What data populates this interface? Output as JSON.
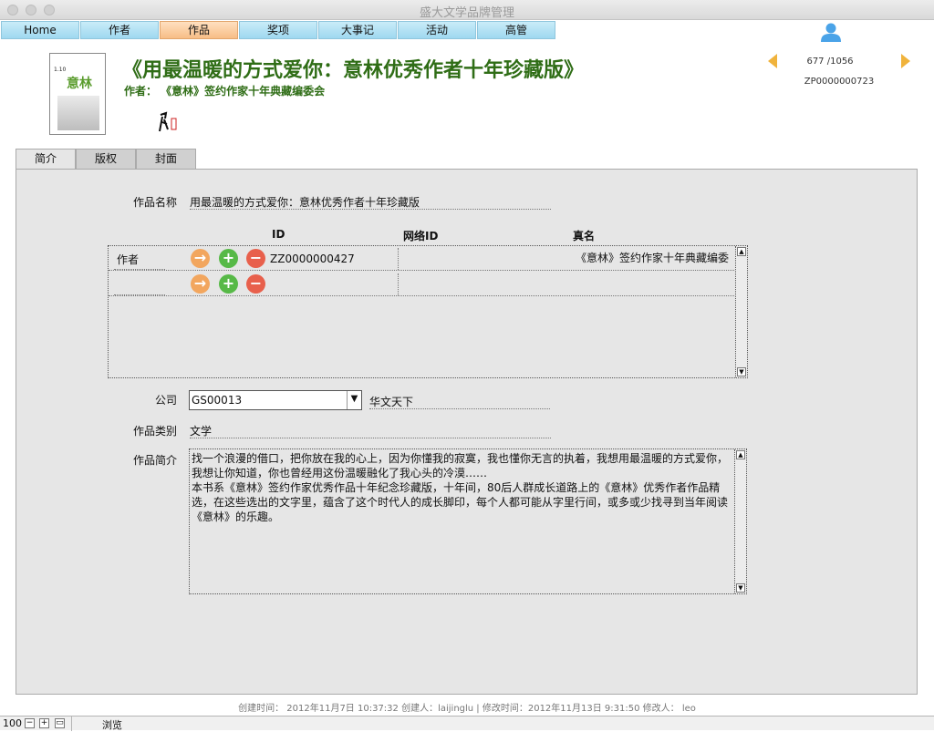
{
  "window": {
    "title": "盛大文学品牌管理"
  },
  "nav": [
    "Home",
    "作者",
    "作品",
    "奖项",
    "大事记",
    "活动",
    "高管"
  ],
  "header": {
    "title": "《用最温暖的方式爱你：意林优秀作者十年珍藏版》",
    "author_line": "作者： 《意林》签约作家十年典藏编委会",
    "record_count": "677 /1056",
    "record_id": "ZP0000000723",
    "cover_logo": "意林",
    "cover_top": "1.10"
  },
  "tabs": [
    "简介",
    "版权",
    "封面"
  ],
  "form": {
    "name_label": "作品名称",
    "name_value": "用最温暖的方式爱你：意林优秀作者十年珍藏版",
    "columns": {
      "id": "ID",
      "net_id": "网络ID",
      "real_name": "真名"
    },
    "author_label": "作者",
    "author_rows": [
      {
        "id": "ZZ0000000427",
        "net_id": "",
        "real_name": "《意林》签约作家十年典藏编委"
      },
      {
        "id": "",
        "net_id": "",
        "real_name": ""
      }
    ],
    "company_label": "公司",
    "company_id": "GS00013",
    "company_name": "华文天下",
    "category_label": "作品类别",
    "category_value": "文学",
    "summary_label": "作品简介",
    "summary_text": "找一个浪漫的借口，把你放在我的心上，因为你懂我的寂寞，我也懂你无言的执着，我想用最温暖的方式爱你，我想让你知道，你也曾经用这份温暖融化了我心头的冷漠……\n本书系《意林》签约作家优秀作品十年纪念珍藏版，十年间，80后人群成长道路上的《意林》优秀作者作品精选，在这些选出的文字里，蕴含了这个时代人的成长脚印，每个人都可能从字里行间，或多或少找寻到当年阅读《意林》的乐趣。"
  },
  "meta": "创建时间： 2012年11月7日  10:37:32 创建人：laijinglu | 修改时间：2012年11月13日  9:31:50 修改人： leo",
  "status": {
    "zoom": "100",
    "mode": "浏览"
  },
  "colors": {
    "title_green": "#2f6d16",
    "nav_blue": "#9fd8f0",
    "nav_active": "#f7bd86",
    "panel_gray": "#e6e6e6"
  }
}
